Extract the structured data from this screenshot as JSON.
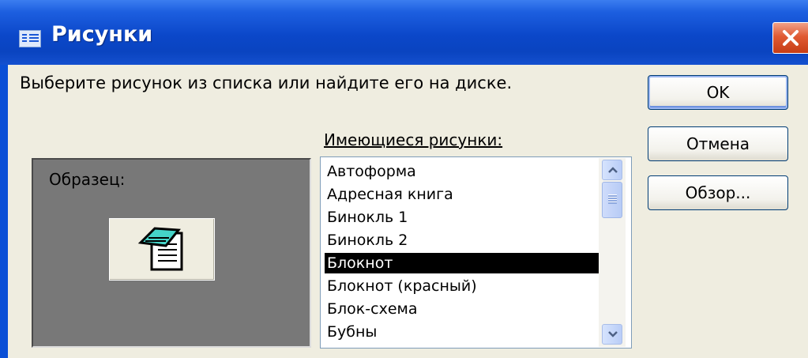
{
  "window": {
    "title": "Рисунки"
  },
  "dialog": {
    "prompt": "Выберите рисунок из списка или найдите его на диске.",
    "sample_label": "Образец:",
    "list_label": "Имеющиеся рисунки:",
    "list_items": [
      "Автоформа",
      "Адресная книга",
      "Бинокль 1",
      "Бинокль 2",
      "Блокнот",
      "Блокнот (красный)",
      "Блок-схема",
      "Бубны"
    ],
    "selected_item": "Блокнот"
  },
  "buttons": {
    "ok": "OK",
    "cancel": "Отмена",
    "browse": "Обзор..."
  },
  "icons": {
    "title_icon": "form-icon",
    "sample_icon": "notepad-icon",
    "close_icon": "close-icon"
  },
  "colors": {
    "titlebar": "#0a4fd6",
    "close_button": "#e05a33",
    "dialog_background": "#efede0",
    "selection": "#000000"
  }
}
